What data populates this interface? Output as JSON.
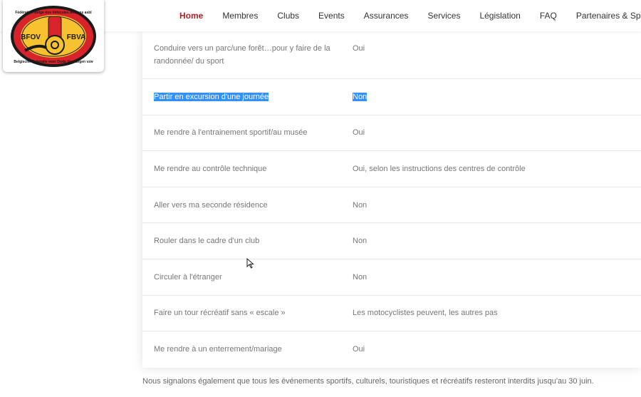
{
  "nav": {
    "items": [
      "Home",
      "Membres",
      "Clubs",
      "Events",
      "Assurances",
      "Services",
      "Législation",
      "FAQ",
      "Partenaires & Spécia"
    ],
    "active_index": 0
  },
  "logo": {
    "left_text": "BFOV",
    "right_text": "FBVA",
    "arc_top": "Fédération Belge des Véhicules Anciens asbl",
    "arc_bottom": "Belgische Federatie voor Oude Voertuigen vzw"
  },
  "table": {
    "rows": [
      {
        "q": "Conduire vers un parc/une forêt…pour y faire de la randonnée/ du sport",
        "a": "Oui"
      },
      {
        "q": "Partir en excursion d'une journée",
        "a": "Non"
      },
      {
        "q": "Me rendre à l'entrainement sportif/au musée",
        "a": "Oui"
      },
      {
        "q": "Me rendre au contrôle technique",
        "a": "Oui, selon les instructions des centres de contrôle"
      },
      {
        "q": "Aller vers ma seconde résidence",
        "a": "Non"
      },
      {
        "q": "Rouler dans le cadre d'un club",
        "a": "Non"
      },
      {
        "q": "Circuler à l'étranger",
        "a": "Non"
      },
      {
        "q": "Faire un tour récréatif sans « escale »",
        "a": "Les motocyclistes peuvent, les autres pas"
      },
      {
        "q": "Me rendre à un enterrement/mariage",
        "a": "Oui"
      }
    ]
  },
  "note": "Nous signalons également que tous les événements sportifs, culturels, touristiques et récréatifs resteront interdits jusqu'au 30 juin.",
  "colors": {
    "accent": "#b01e23",
    "selection": "#3390ff"
  }
}
